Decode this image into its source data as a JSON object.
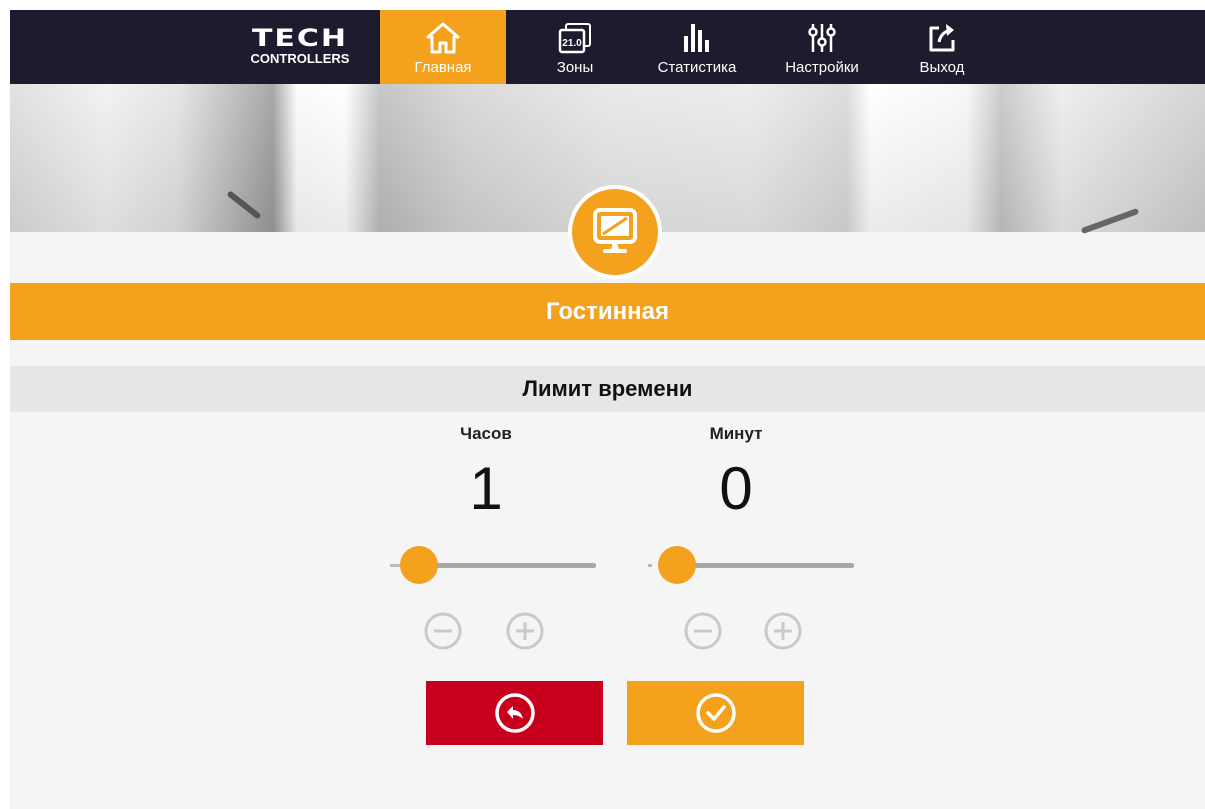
{
  "brand": {
    "name": "TECH",
    "subtitle": "CONTROLLERS"
  },
  "nav": {
    "items": [
      {
        "label": "Главная",
        "icon": "home-icon",
        "active": true
      },
      {
        "label": "Зоны",
        "icon": "zones-icon",
        "badge": "21.0"
      },
      {
        "label": "Статистика",
        "icon": "statistics-icon"
      },
      {
        "label": "Настройки",
        "icon": "settings-sliders-icon"
      },
      {
        "label": "Выход",
        "icon": "logout-icon"
      }
    ]
  },
  "zone": {
    "icon": "monitor-icon",
    "name": "Гостинная"
  },
  "time_limit": {
    "title": "Лимит времени",
    "hours": {
      "label": "Часов",
      "value": "1",
      "slider_fraction": 0.0
    },
    "minutes": {
      "label": "Минут",
      "value": "0",
      "slider_fraction": 0.0
    }
  },
  "buttons": {
    "back_icon": "undo-icon",
    "confirm_icon": "check-circle-icon"
  },
  "colors": {
    "accent": "#f4a11d",
    "nav_bg": "#1c1c2e",
    "danger": "#c8001e",
    "header_bg": "#e6e6e6",
    "page_bg": "#f5f5f5"
  }
}
